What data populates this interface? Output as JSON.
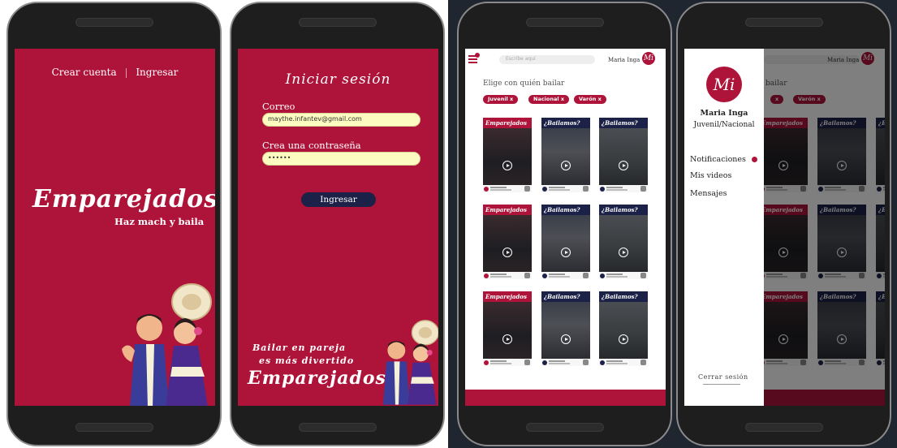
{
  "screen1": {
    "links": [
      "Crear cuenta",
      "Ingresar"
    ],
    "brand": "Emparejados",
    "tagline": "Haz mach y baila"
  },
  "screen2": {
    "title": "Iniciar sesión",
    "email_label": "Correo",
    "email_value": "maythe.infantev@gmail.com",
    "password_label": "Crea una contraseña",
    "password_value": "••••••",
    "submit_label": "Ingresar",
    "slogan_line1": "Bailar en pareja",
    "slogan_line2": "es más divertido",
    "brand": "Emparejados"
  },
  "screen3": {
    "search_placeholder": "Escribe aquí",
    "user_name": "Maria Inga",
    "avatar_initials": "Mi",
    "section_title": "Elige con quién bailar",
    "filters": [
      "Juvenil x",
      "Nacional x",
      "Varón x"
    ],
    "cards": [
      {
        "head": "Emparejados",
        "color": "#ae143a"
      },
      {
        "head": "¿Bailamos?",
        "color": "#1c2148"
      },
      {
        "head": "¿Bailamos?",
        "color": "#1c2148"
      },
      {
        "head": "Emparejados",
        "color": "#ae143a"
      },
      {
        "head": "¿Bailamos?",
        "color": "#1c2148"
      },
      {
        "head": "¿Bailamos?",
        "color": "#1c2148"
      },
      {
        "head": "Emparejados",
        "color": "#ae143a"
      },
      {
        "head": "¿Bailamos?",
        "color": "#1c2148"
      },
      {
        "head": "¿Bailamos?",
        "color": "#1c2148"
      }
    ]
  },
  "screen4": {
    "avatar_initials": "Mi",
    "name": "Maria Inga",
    "category": "Juvenil/Nacional",
    "menu": [
      "Notificaciones",
      "Mis videos",
      "Mensajes"
    ],
    "logout": "Cerrar sesión",
    "bg_user_name": "Maria Inga",
    "bg_section_title": "bailar",
    "bg_filters": [
      "x",
      "Varón x"
    ]
  },
  "colors": {
    "primary": "#ae143a",
    "navy": "#1c2148",
    "input_bg": "#fdfcc0"
  }
}
